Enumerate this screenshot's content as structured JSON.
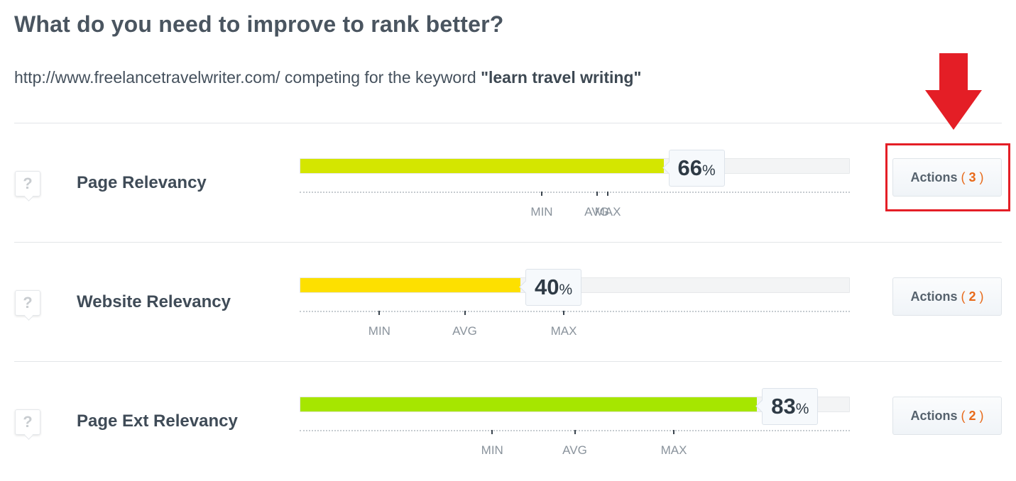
{
  "title": "What do you need to improve to rank better?",
  "subtitle": {
    "url": "http://www.freelancetravelwriter.com/",
    "middle": " competing for the keyword ",
    "keyword": "\"learn travel writing\""
  },
  "colors": {
    "accent": "#e86a1a",
    "annotation": "#e41e26"
  },
  "metrics": [
    {
      "label": "Page Relevancy",
      "help": "?",
      "percent": 66,
      "percent_text": "66",
      "pct_sign": "%",
      "fill_color": "#d4e600",
      "scale": {
        "min_label": "MIN",
        "avg_label": "AVG",
        "max_label": "MAX",
        "min": 44,
        "avg": 54,
        "max": 56
      },
      "actions": {
        "label": "Actions",
        "open": "( ",
        "count": "3",
        "close": " )"
      }
    },
    {
      "label": "Website Relevancy",
      "help": "?",
      "percent": 40,
      "percent_text": "40",
      "pct_sign": "%",
      "fill_color": "#fde000",
      "scale": {
        "min_label": "MIN",
        "avg_label": "AVG",
        "max_label": "MAX",
        "min": 14.5,
        "avg": 30,
        "max": 48
      },
      "actions": {
        "label": "Actions",
        "open": "( ",
        "count": "2",
        "close": " )"
      }
    },
    {
      "label": "Page Ext Relevancy",
      "help": "?",
      "percent": 83,
      "percent_text": "83",
      "pct_sign": "%",
      "fill_color": "#a6e600",
      "scale": {
        "min_label": "MIN",
        "avg_label": "AVG",
        "max_label": "MAX",
        "min": 35,
        "avg": 50,
        "max": 68
      },
      "actions": {
        "label": "Actions",
        "open": "( ",
        "count": "2",
        "close": " )"
      }
    }
  ]
}
